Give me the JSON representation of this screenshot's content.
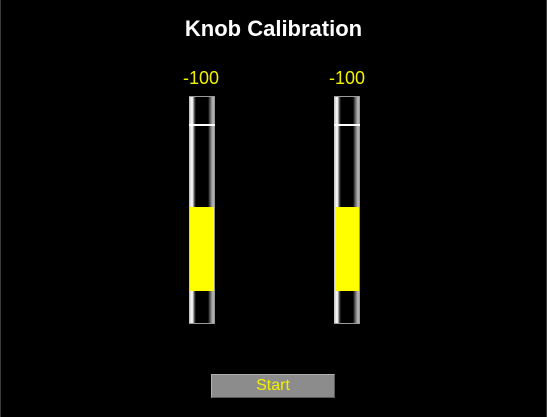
{
  "title": "Knob Calibration",
  "colors": {
    "background": "#000000",
    "accent": "#ffff00",
    "readout": "#f2f200",
    "button": "#8c8c8c"
  },
  "meters": [
    {
      "readout": "-100",
      "level": 0.37,
      "marker": 0.87
    },
    {
      "readout": "-100",
      "level": 0.37,
      "marker": 0.87
    }
  ],
  "start_button": {
    "label": "Start"
  }
}
